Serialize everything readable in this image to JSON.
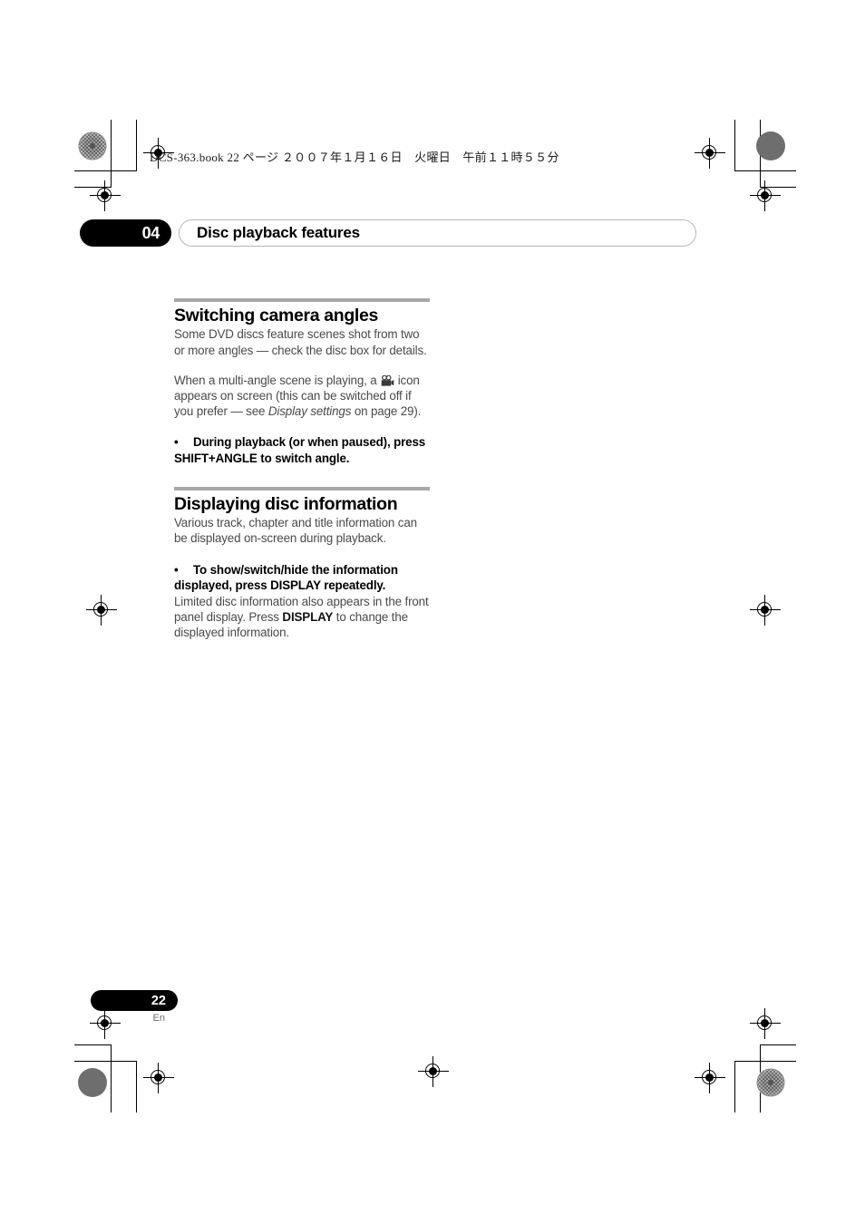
{
  "print_header": {
    "text": "DCS-363.book  22 ページ  ２００７年１月１６日　火曜日　午前１１時５５分"
  },
  "chapter": {
    "number": "04",
    "title": "Disc playback features"
  },
  "sections": [
    {
      "heading": "Switching camera angles",
      "paragraph_1": "Some DVD discs feature scenes shot from two or more angles — check the disc box for details.",
      "paragraph_2_part_1": "When a multi-angle scene is playing, a ",
      "paragraph_2_part_2": " icon appears on screen (this can be switched off if you prefer — see ",
      "paragraph_2_italic": "Display settings",
      "paragraph_2_part_3": " on page 29).",
      "bullet_marker": "•",
      "bullet_text": "During playback (or when paused), press SHIFT+ANGLE to switch angle."
    },
    {
      "heading": "Displaying disc information",
      "paragraph_1": "Various track, chapter and title information can be displayed on-screen during playback.",
      "bullet_marker": "•",
      "bullet_text": "To show/switch/hide the information displayed, press DISPLAY repeatedly.",
      "paragraph_2_part_1": "Limited disc information also appears in the front panel display. Press ",
      "paragraph_2_bold": "DISPLAY",
      "paragraph_2_part_2": " to change the displayed information."
    }
  ],
  "footer": {
    "page_number": "22",
    "language_code": "En"
  }
}
